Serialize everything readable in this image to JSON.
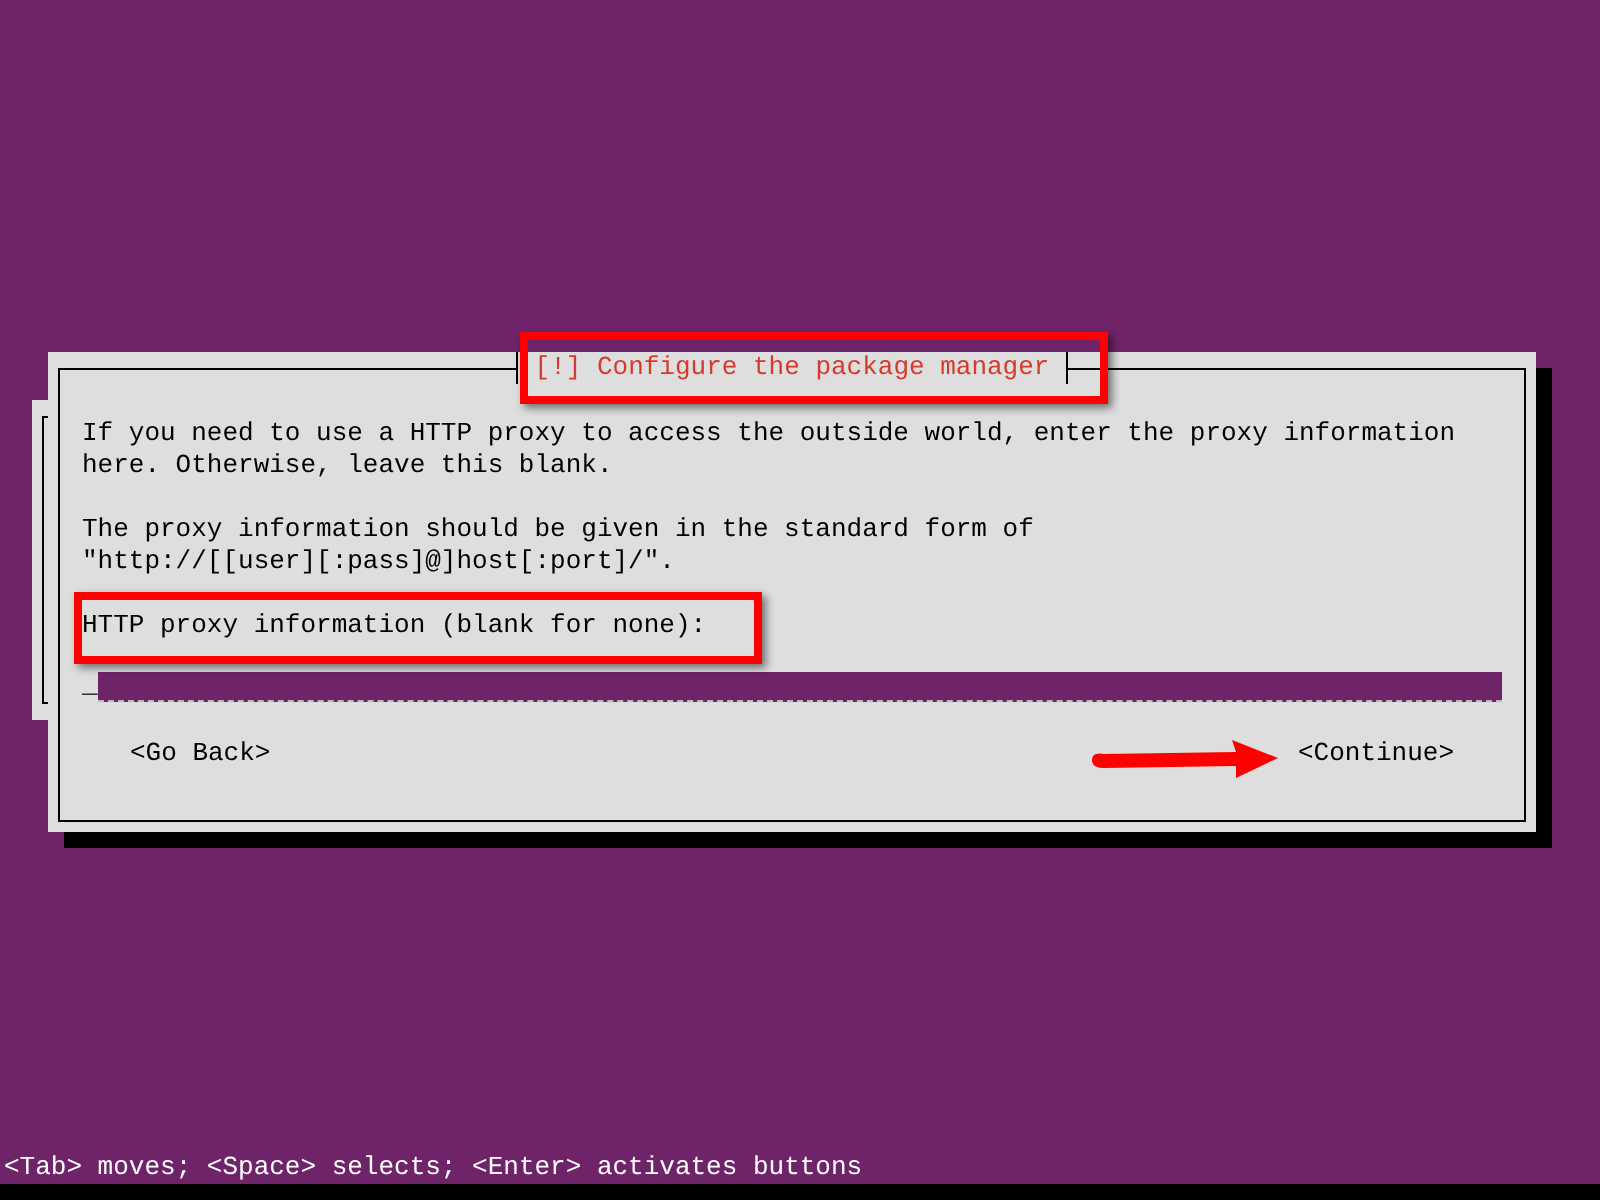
{
  "dialog": {
    "title": "[!] Configure the package manager",
    "paragraphs": [
      [
        "If you need to use a HTTP proxy to access the outside world, enter the proxy information",
        "here. Otherwise, leave this blank."
      ],
      [
        "The proxy information should be given in the standard form of",
        "\"http://[[user][:pass]@]host[:port]/\"."
      ]
    ],
    "field": {
      "label": "HTTP proxy information (blank for none):",
      "cursor": "_"
    },
    "buttons": [
      {
        "label": "<Go Back>",
        "selected": false
      },
      {
        "label": "<Continue>",
        "selected": false
      }
    ]
  },
  "status_bar": "<Tab> moves; <Space> selects; <Enter> activates buttons"
}
